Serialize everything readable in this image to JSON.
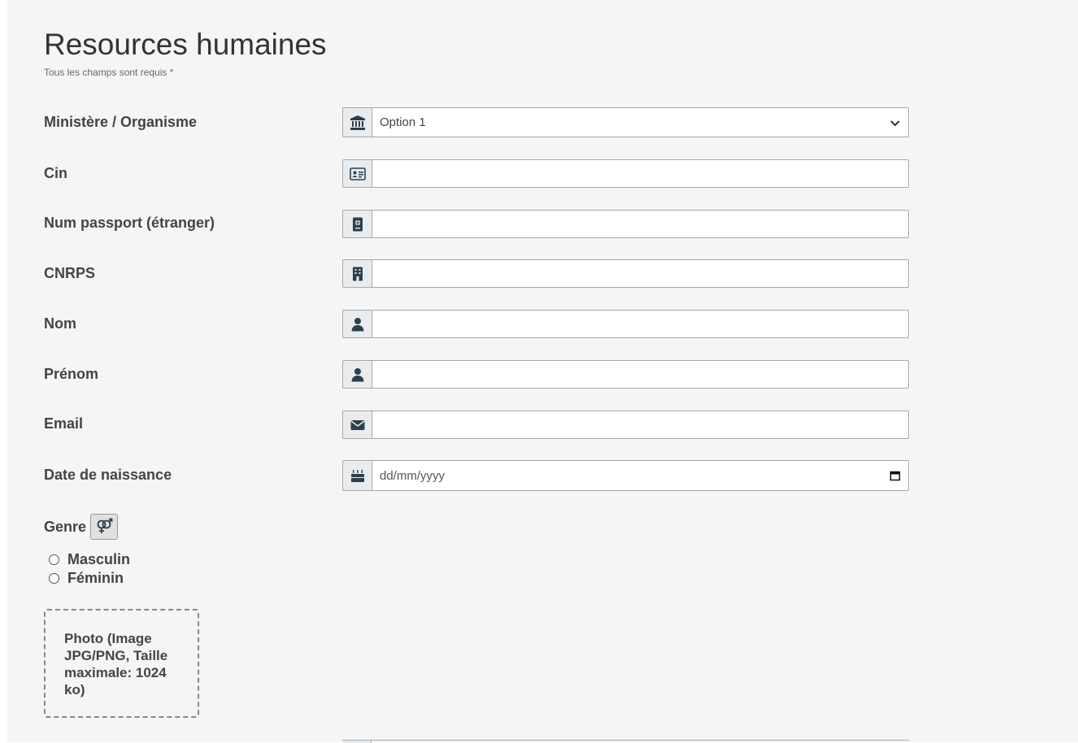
{
  "header": {
    "title": "Resources humaines",
    "subtitle": "Tous les champs sont requis *"
  },
  "fields": [
    {
      "label": "Ministère / Organisme",
      "icon": "institution-icon",
      "type": "select",
      "value": "Option 1",
      "placeholder": ""
    },
    {
      "label": "Cin",
      "icon": "id-card-icon",
      "type": "text",
      "value": "",
      "placeholder": ""
    },
    {
      "label": "Num passport (étranger)",
      "icon": "passport-icon",
      "type": "text",
      "value": "",
      "placeholder": ""
    },
    {
      "label": "CNRPS",
      "icon": "building-icon",
      "type": "text",
      "value": "",
      "placeholder": ""
    },
    {
      "label": "Nom",
      "icon": "user-icon",
      "type": "text",
      "value": "",
      "placeholder": ""
    },
    {
      "label": "Prénom",
      "icon": "user-icon",
      "type": "text",
      "value": "",
      "placeholder": ""
    },
    {
      "label": "Email",
      "icon": "envelope-icon",
      "type": "text",
      "value": "",
      "placeholder": ""
    },
    {
      "label": "Date de naissance",
      "icon": "birthday-cake-icon",
      "type": "date",
      "value": "",
      "placeholder": "dd/mm/yyyy"
    }
  ],
  "genre": {
    "label": "Genre",
    "icon": "venus-mars-icon",
    "options": [
      "Masculin",
      "Féminin"
    ]
  },
  "photo": {
    "label": "Photo (Image JPG/PNG, Taille maximale: 1024 ko)"
  },
  "colors": {
    "panel_bg": "#f5f5f5",
    "addon_bg": "#e9ecef",
    "icon_color": "#2b3f4c",
    "border": "#a8a8a8"
  }
}
